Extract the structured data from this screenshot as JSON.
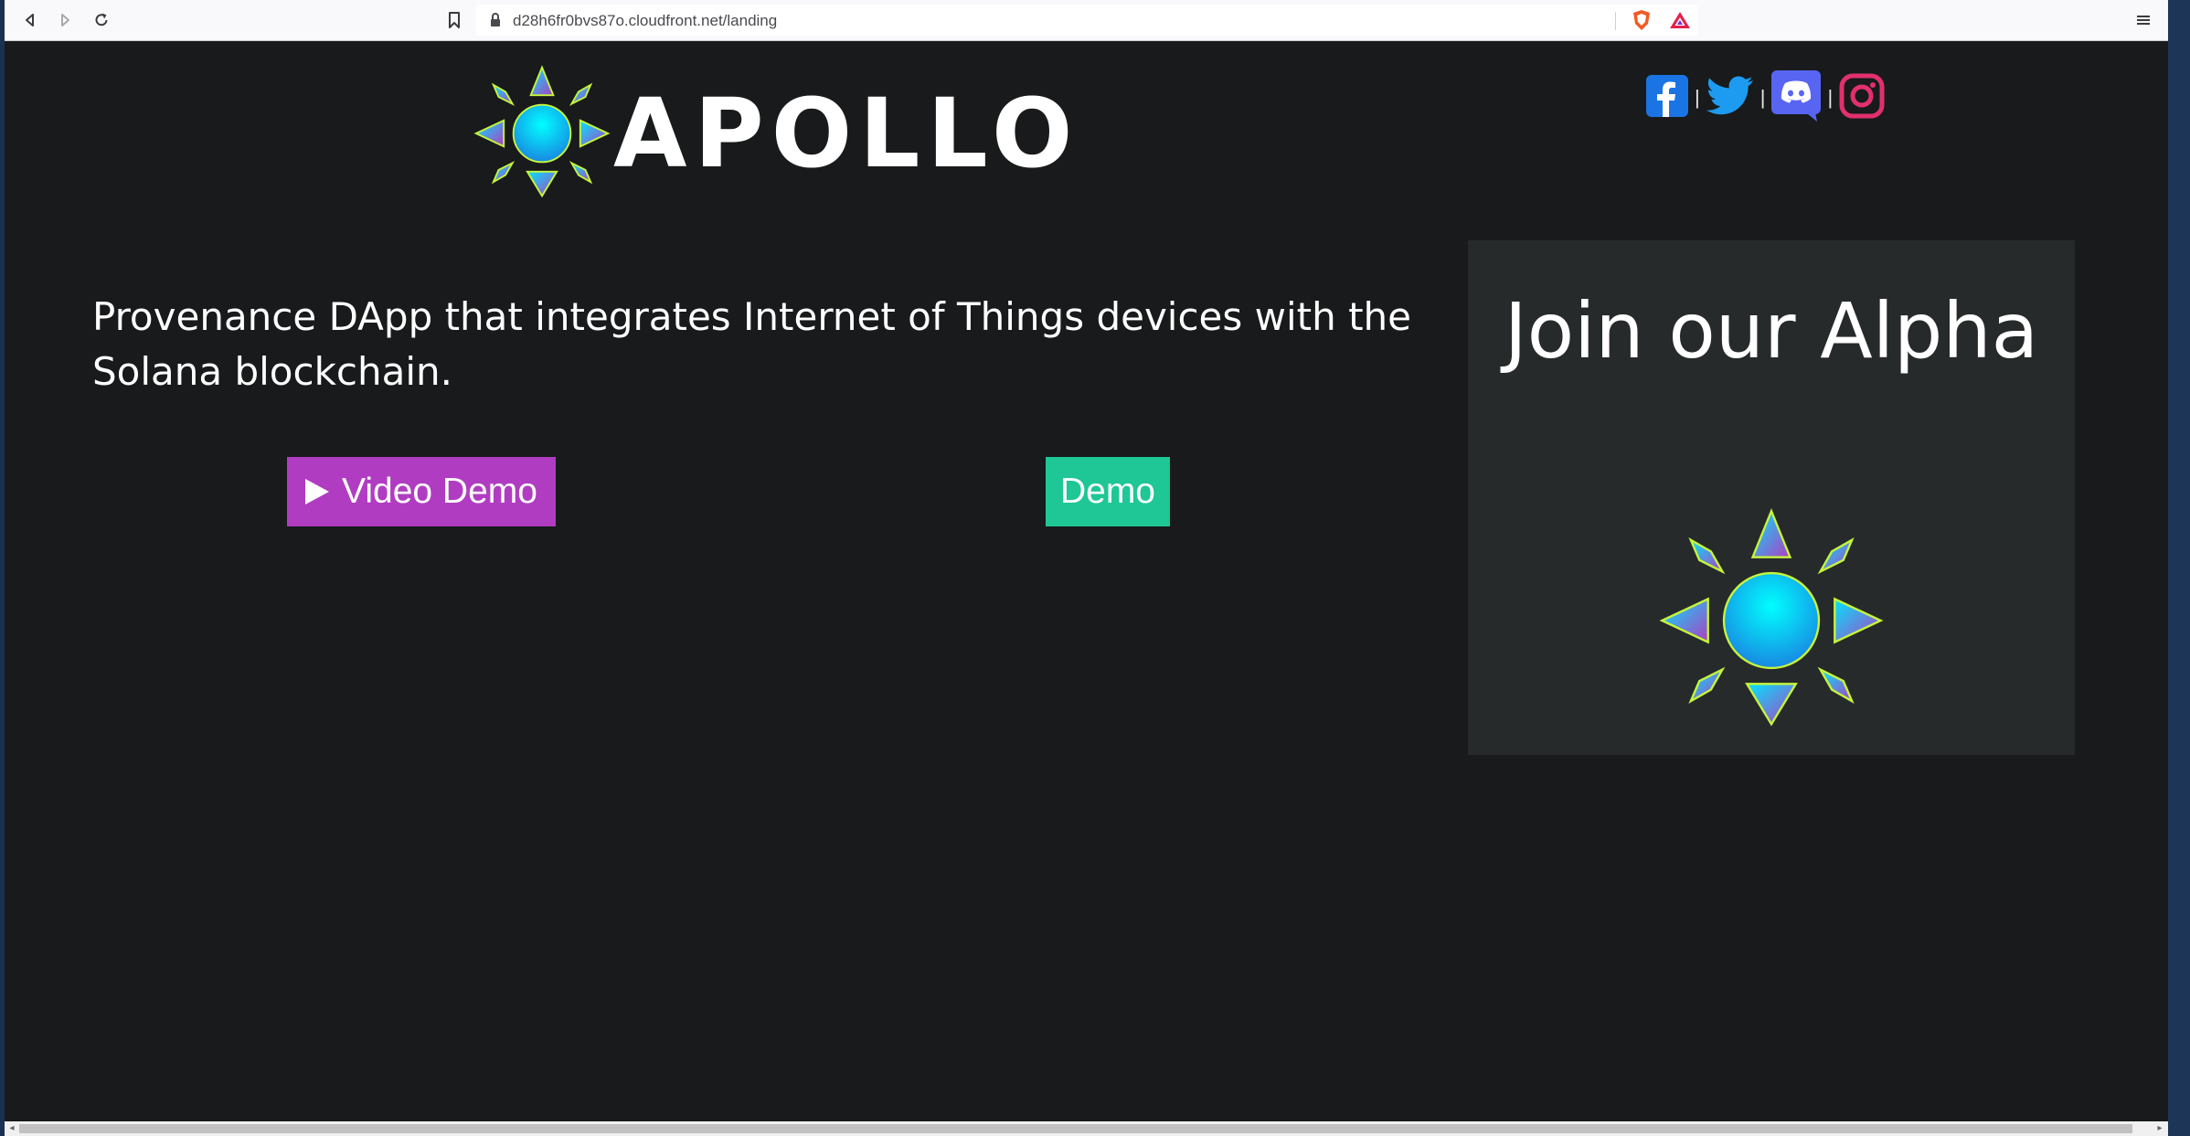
{
  "browser": {
    "url": "d28h6fr0bvs87o.cloudfront.net/landing",
    "icons": [
      "back-icon",
      "forward-icon",
      "reload-icon",
      "bookmark-icon",
      "lock-icon",
      "brave-shields-icon",
      "brave-rewards-icon",
      "menu-icon"
    ]
  },
  "header": {
    "logo_text": "APOLLO",
    "social": [
      "facebook-icon",
      "twitter-icon",
      "discord-icon",
      "instagram-icon"
    ],
    "separator": "|"
  },
  "main": {
    "tagline": "Provenance DApp that integrates Internet of Things devices with the Solana blockchain.",
    "video_demo_label": "Video Demo",
    "demo_label": "Demo"
  },
  "alpha": {
    "title": "Join our Alpha"
  },
  "colors": {
    "page_bg": "#181a1b",
    "card_bg": "#272a2b",
    "video_button": "#b03dc1",
    "demo_button": "#1ec795",
    "logo_cyan": "#00e5ff",
    "logo_purple": "#b03dc1",
    "logo_outline": "#c6f53b",
    "facebook": "#1b74e4",
    "twitter": "#1d9bf0",
    "discord": "#5865f2",
    "instagram": "#e1306c"
  }
}
